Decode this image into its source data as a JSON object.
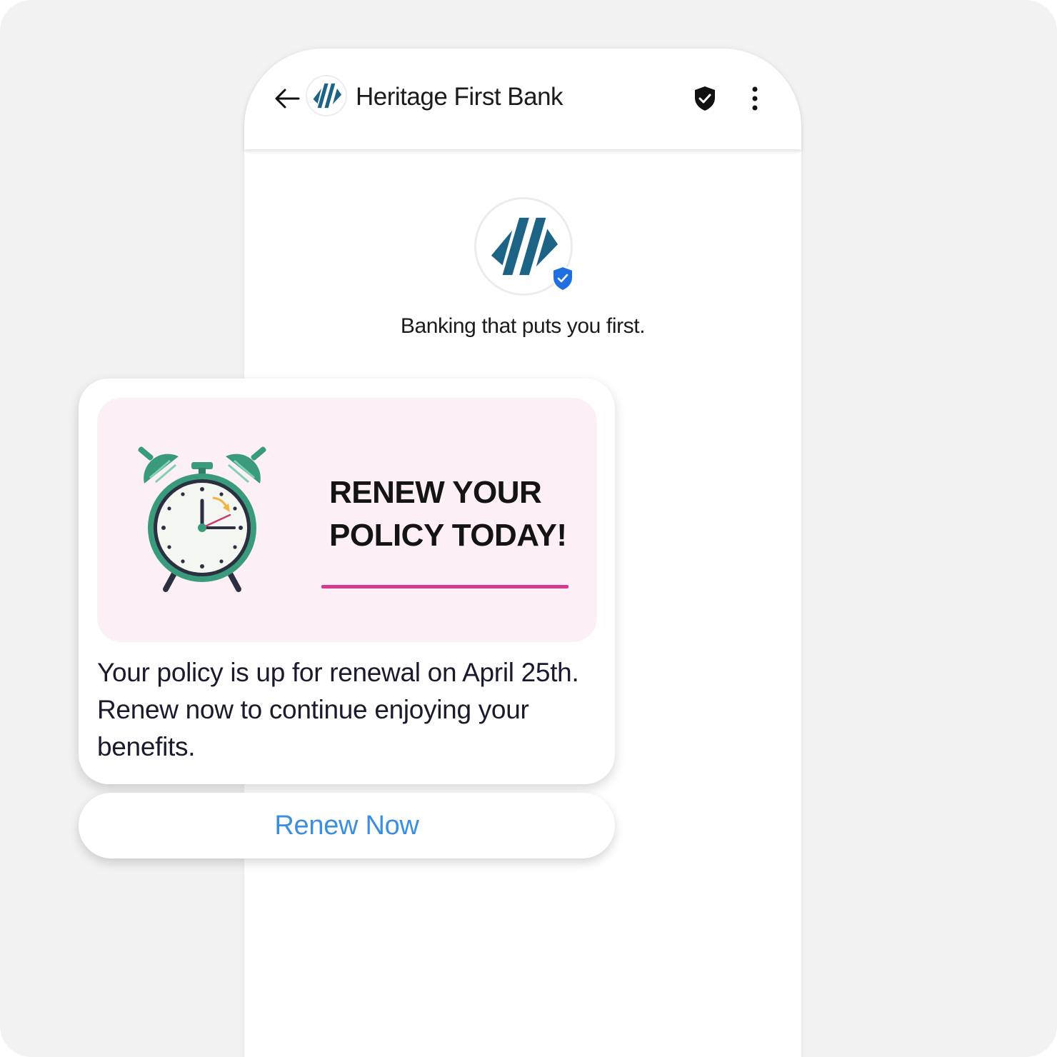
{
  "header": {
    "title": "Heritage First Bank",
    "back_icon": "arrow-left-icon",
    "verified_icon": "shield-check-icon",
    "more_icon": "more-vertical-icon"
  },
  "profile": {
    "tagline": "Banking that puts you first.",
    "badge_icon": "verified-badge-icon"
  },
  "card": {
    "banner_title_line1": "RENEW YOUR",
    "banner_title_line2": "POLICY TODAY!",
    "banner_image": "alarm-clock-illustration",
    "body": "Your policy is up for renewal on April 25th. Renew now to continue enjoying your benefits."
  },
  "action": {
    "label": "Renew Now"
  },
  "colors": {
    "brand": "#1d6385",
    "accent_underline": "#d63a8e",
    "banner_background": "#fcf0f6",
    "link_blue": "#3b8fe0",
    "clock_green": "#3a9a7c"
  }
}
